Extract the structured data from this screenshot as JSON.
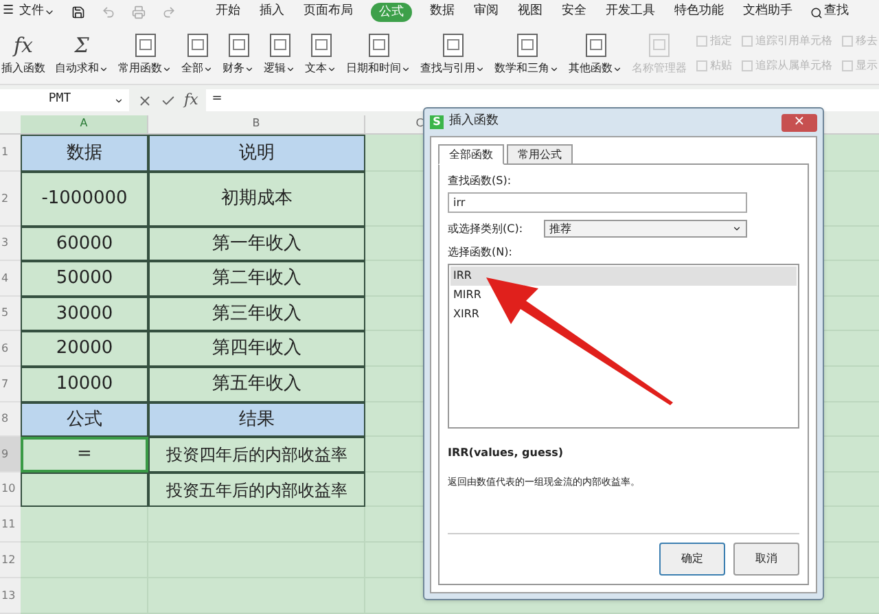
{
  "menu_bar": {
    "menu_icon": "☰",
    "file": "文件",
    "tabs": [
      {
        "label": "开始",
        "selected": false
      },
      {
        "label": "插入",
        "selected": false
      },
      {
        "label": "页面布局",
        "selected": false
      },
      {
        "label": "公式",
        "selected": true
      },
      {
        "label": "数据",
        "selected": false
      },
      {
        "label": "审阅",
        "selected": false
      },
      {
        "label": "视图",
        "selected": false
      },
      {
        "label": "安全",
        "selected": false
      },
      {
        "label": "开发工具",
        "selected": false
      },
      {
        "label": "特色功能",
        "selected": false
      },
      {
        "label": "文档助手",
        "selected": false
      }
    ],
    "search": "查找"
  },
  "ribbon": [
    {
      "kind": "large",
      "glyph": "fx",
      "label": "插入函数",
      "dropdown": false,
      "disabled": false
    },
    {
      "kind": "large",
      "glyph": "Σ",
      "label": "自动求和",
      "dropdown": true,
      "disabled": false
    },
    {
      "kind": "large",
      "label": "常用函数",
      "dropdown": true,
      "disabled": false
    },
    {
      "kind": "large",
      "label": "全部",
      "dropdown": true,
      "disabled": false
    },
    {
      "kind": "large",
      "label": "财务",
      "dropdown": true,
      "disabled": false
    },
    {
      "kind": "large",
      "label": "逻辑",
      "dropdown": true,
      "disabled": false
    },
    {
      "kind": "large",
      "label": "文本",
      "dropdown": true,
      "disabled": false
    },
    {
      "kind": "large",
      "label": "日期和时间",
      "dropdown": true,
      "disabled": false
    },
    {
      "kind": "large",
      "label": "查找与引用",
      "dropdown": true,
      "disabled": false
    },
    {
      "kind": "large",
      "label": "数学和三角",
      "dropdown": true,
      "disabled": false
    },
    {
      "kind": "large",
      "label": "其他函数",
      "dropdown": true,
      "disabled": false
    },
    {
      "kind": "large",
      "label": "名称管理器",
      "dropdown": false,
      "disabled": true
    },
    {
      "kind": "stack",
      "items": [
        "指定",
        "粘贴"
      ],
      "disabled": true
    },
    {
      "kind": "stack",
      "items": [
        "追踪引用单元格",
        "追踪从属单元格"
      ],
      "disabled": true
    },
    {
      "kind": "stack",
      "items": [
        "移去",
        "显示"
      ],
      "disabled": true
    }
  ],
  "formula_bar": {
    "name_box": "PMT",
    "fx": "fx",
    "value": "="
  },
  "sheet": {
    "columns": [
      {
        "label": "A",
        "selected": true
      },
      {
        "label": "B",
        "selected": false
      },
      {
        "label": "C",
        "selected": false
      }
    ],
    "rows": [
      {
        "number": "1",
        "kind": "header",
        "cells": [
          {
            "text": "数据",
            "selected": false
          },
          {
            "text": "说明",
            "selected": false
          }
        ]
      },
      {
        "number": "2",
        "kind": "data",
        "cells": [
          {
            "text": "-1000000",
            "selected": false
          },
          {
            "text": "初期成本",
            "selected": false
          }
        ]
      },
      {
        "number": "3",
        "kind": "data",
        "cells": [
          {
            "text": "60000",
            "selected": false
          },
          {
            "text": "第一年收入",
            "selected": false
          }
        ]
      },
      {
        "number": "4",
        "kind": "data",
        "cells": [
          {
            "text": "50000",
            "selected": false
          },
          {
            "text": "第二年收入",
            "selected": false
          }
        ]
      },
      {
        "number": "5",
        "kind": "data",
        "cells": [
          {
            "text": "30000",
            "selected": false
          },
          {
            "text": "第三年收入",
            "selected": false
          }
        ]
      },
      {
        "number": "6",
        "kind": "data",
        "cells": [
          {
            "text": "20000",
            "selected": false
          },
          {
            "text": "第四年收入",
            "selected": false
          }
        ]
      },
      {
        "number": "7",
        "kind": "data",
        "cells": [
          {
            "text": "10000",
            "selected": false
          },
          {
            "text": "第五年收入",
            "selected": false
          }
        ]
      },
      {
        "number": "8",
        "kind": "header",
        "cells": [
          {
            "text": "公式",
            "selected": false
          },
          {
            "text": "结果",
            "selected": false
          }
        ]
      },
      {
        "number": "9",
        "kind": "data",
        "cells": [
          {
            "text": "=",
            "selected": true
          },
          {
            "text": "投资四年后的内部收益率",
            "selected": false
          }
        ]
      },
      {
        "number": "10",
        "kind": "data",
        "cells": [
          {
            "text": "",
            "selected": false
          },
          {
            "text": "投资五年后的内部收益率",
            "selected": false
          }
        ]
      },
      {
        "number": "11",
        "kind": "empty",
        "cells": []
      },
      {
        "number": "12",
        "kind": "empty",
        "cells": []
      },
      {
        "number": "13",
        "kind": "empty",
        "cells": []
      }
    ]
  },
  "dialog": {
    "logo": "S",
    "title": "插入函数",
    "close": "×",
    "tabs": [
      {
        "label": "全部函数",
        "selected": true
      },
      {
        "label": "常用公式",
        "selected": false
      }
    ],
    "search_label": "查找函数(S):",
    "search_value": "irr",
    "category_label": "或选择类别(C):",
    "category_value": "推荐",
    "list_label": "选择函数(N):",
    "functions": [
      {
        "name": "IRR",
        "selected": true
      },
      {
        "name": "MIRR",
        "selected": false
      },
      {
        "name": "XIRR",
        "selected": false
      }
    ],
    "signature": "IRR(values, guess)",
    "description": "返回由数值代表的一组现金流的内部收益率。",
    "buttons": [
      "确定",
      "取消"
    ]
  }
}
